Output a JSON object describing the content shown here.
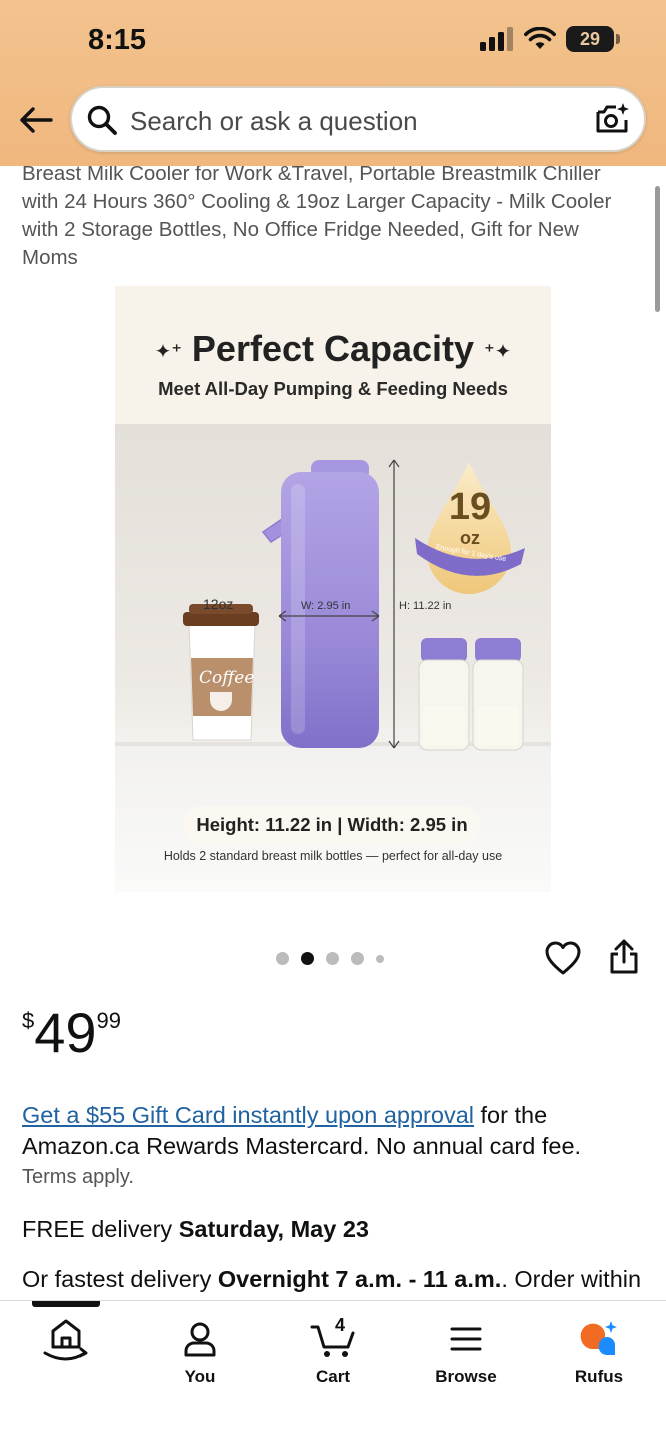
{
  "status_bar": {
    "time": "8:15",
    "battery": "29"
  },
  "search": {
    "placeholder": "Search or ask a question"
  },
  "product": {
    "title": "Breast Milk Cooler for Work &Travel, Portable Breastmilk Chiller with 24 Hours 360° Cooling & 19oz Larger Capacity - Milk Cooler with 2 Storage Bottles, No Office Fridge Needed, Gift for New Moms",
    "image": {
      "headline": "Perfect Capacity",
      "subheadline": "Meet All-Day Pumping & Feeding Needs",
      "coffee_size": "12oz",
      "coffee_label": "Coffee",
      "width_label": "W: 2.95 in",
      "height_label": "H: 11.22 in",
      "capacity_number": "19",
      "capacity_unit": "oz",
      "capacity_ribbon": "Enough for 1 day's use",
      "dimensions": "Height: 11.22 in | Width: 2.95 in",
      "caption": "Holds 2 standard breast milk bottles — perfect for all-day use"
    },
    "carousel": {
      "total": 5,
      "active": 2
    },
    "price": {
      "symbol": "$",
      "whole": "49",
      "fraction": "99"
    }
  },
  "offer": {
    "link": "Get a $55 Gift Card instantly upon approval",
    "text": " for the Amazon.ca Rewards Mastercard. No annual card fee.",
    "terms": "Terms apply."
  },
  "delivery": {
    "free_prefix": "FREE delivery ",
    "free_date": "Saturday, May 23",
    "fast_prefix": "Or fastest delivery ",
    "fast_window": "Overnight 7 a.m. - 11 a.m.",
    "fast_suffix": ". Order within"
  },
  "bottom_nav": {
    "home": "",
    "you": "You",
    "cart": "Cart",
    "cart_count": "4",
    "browse": "Browse",
    "rufus": "Rufus"
  },
  "colors": {
    "header": "#f0b77e",
    "link": "#2162a1",
    "bottle_purple": "#9b89d8",
    "rufus_orange": "#f26b22",
    "rufus_blue": "#1a8cff"
  },
  "icons": [
    "back-arrow-icon",
    "search-icon",
    "camera-icon",
    "heart-icon",
    "share-icon",
    "home-icon",
    "person-icon",
    "cart-icon",
    "menu-icon",
    "rufus-icon"
  ]
}
